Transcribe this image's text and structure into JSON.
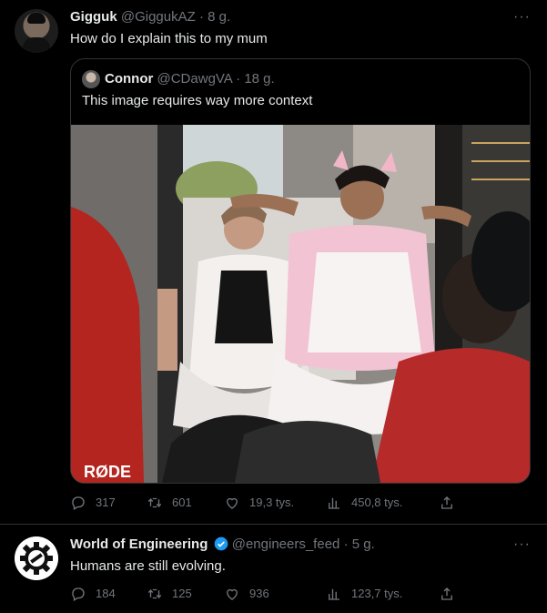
{
  "tweets": [
    {
      "name": "Gigguk",
      "handle": "@GiggukAZ",
      "time": "8 g.",
      "text": "How do I explain this to my mum",
      "quote": {
        "name": "Connor",
        "handle": "@CDawgVA",
        "time": "18 g.",
        "text": "This image requires way more context",
        "photo_logo_text": "RØDE"
      },
      "stats": {
        "replies": "317",
        "retweets": "601",
        "likes": "19,3 tys.",
        "views": "450,8 tys."
      }
    },
    {
      "name": "World of Engineering",
      "handle": "@engineers_feed",
      "time": "5 g.",
      "text": "Humans are still evolving.",
      "stats": {
        "replies": "184",
        "retweets": "125",
        "likes": "936",
        "views": "123,7 tys."
      }
    }
  ],
  "separator": "·",
  "more_label": "···",
  "colors": {
    "background": "#000000",
    "text": "#e7e9ea",
    "muted": "#71767b",
    "border": "#2f3336",
    "verified": "#1d9bf0"
  },
  "icons": [
    "reply-icon",
    "retweet-icon",
    "like-icon",
    "views-icon",
    "share-icon",
    "more-icon",
    "verified-icon"
  ]
}
